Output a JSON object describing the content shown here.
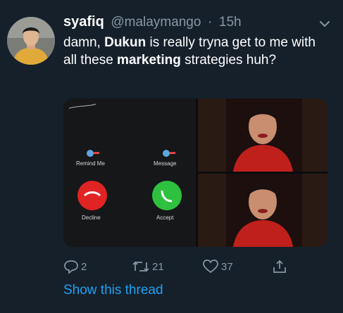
{
  "tweet": {
    "display_name": "syafiq",
    "handle": "@malaymango",
    "separator": "·",
    "time": "15h",
    "text_parts": [
      "damn, ",
      "Dukun",
      " is really tryna get to me with all these ",
      "marketing",
      " strategies huh?"
    ]
  },
  "media": {
    "call_screen": {
      "remind_label": "Remind Me",
      "message_label": "Message",
      "decline_label": "Decline",
      "accept_label": "Accept"
    }
  },
  "actions": {
    "reply_count": "2",
    "retweet_count": "21",
    "like_count": "37"
  },
  "show_thread_label": "Show this thread",
  "colors": {
    "background": "#15202b",
    "secondary_text": "#8899a6",
    "link": "#1da1f2",
    "decline_red": "#e02424",
    "accept_green": "#2ec140"
  },
  "icons": [
    "more-chevron-icon",
    "reply-icon",
    "retweet-icon",
    "like-icon",
    "share-icon"
  ]
}
